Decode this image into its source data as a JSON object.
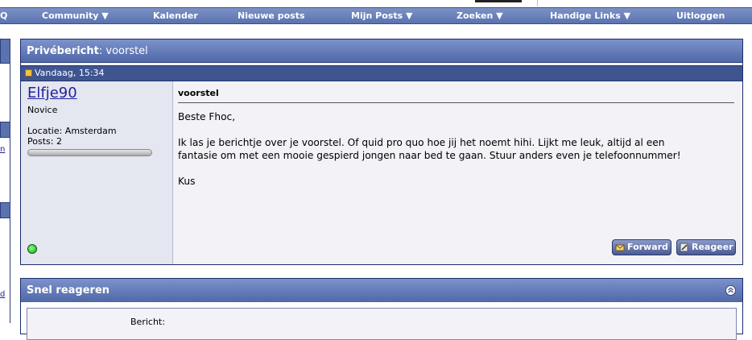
{
  "navbar": {
    "items": [
      "Q",
      "Community ▼",
      "Kalender",
      "Nieuwe posts",
      "Mijn Posts ▼",
      "Zoeken ▼",
      "Handige Links ▼",
      "Uitloggen"
    ]
  },
  "left_sidebar": {
    "links": [
      "n",
      "d"
    ]
  },
  "pm": {
    "title_bold": "Privébericht",
    "title_rest": ": voorstel",
    "date": "Vandaag, 15:34",
    "user": {
      "name": "Elfje90",
      "rank": "Novice",
      "location": "Locatie: Amsterdam",
      "posts": "Posts: 2",
      "status_icon": "online-indicator-icon"
    },
    "subject": "voorstel",
    "body_lines": [
      "Beste Fhoc,",
      "Ik las je berichtje over je voorstel. Of quid pro quo hoe jij het noemt hihi. Lijkt me leuk, altijd al een",
      "fantasie om met een mooie gespierd jongen naar bed te gaan. Stuur anders even je telefoonnummer!",
      "Kus"
    ],
    "buttons": {
      "forward": "Forward",
      "reply": "Reageer"
    }
  },
  "quick_reply": {
    "title": "Snel reageren",
    "message_label": "Bericht:"
  },
  "colors": {
    "header_blue": "#5a72b0",
    "datebar_blue": "#3f5590",
    "link_blue": "#22229c",
    "userbox_bg": "#e4e6f0"
  }
}
